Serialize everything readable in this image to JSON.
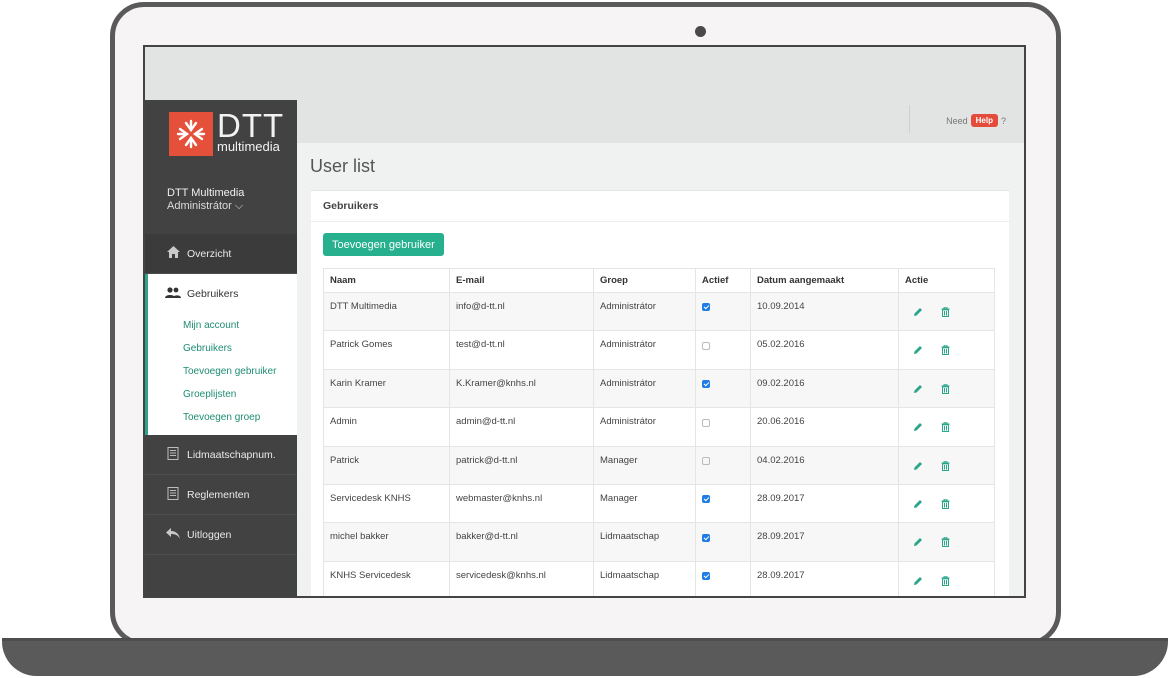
{
  "brand": {
    "logo_text": "DTT",
    "logo_sub": "multimedia",
    "accent": "#27b08e",
    "logo_color": "#e4503a"
  },
  "user": {
    "name": "DTT Multimedia",
    "role": "Administrátor ⌵"
  },
  "nav": {
    "overview": "Overzicht",
    "users": "Gebruikers",
    "sub": [
      "Mijn account",
      "Gebruikers",
      "Toevoegen gebruiker",
      "Groeplijsten",
      "Toevoegen groep"
    ],
    "membership": "Lidmaatschapnum.",
    "rules": "Reglementen",
    "logout": "Uitloggen"
  },
  "topbar": {
    "need": "Need",
    "help": "Help",
    "question": "?"
  },
  "page": {
    "title": "User list",
    "panel_title": "Gebruikers",
    "add_button": "Toevoegen gebruiker"
  },
  "table": {
    "headers": [
      "Naam",
      "E-mail",
      "Groep",
      "Actief",
      "Datum aangemaakt",
      "Actie"
    ],
    "rows": [
      {
        "name": "DTT Multimedia",
        "email": "info@d-tt.nl",
        "group": "Administrátor",
        "active": true,
        "date": "10.09.2014"
      },
      {
        "name": "Patrick Gomes",
        "email": "test@d-tt.nl",
        "group": "Administrátor",
        "active": false,
        "date": "05.02.2016"
      },
      {
        "name": "Karin Kramer",
        "email": "K.Kramer@knhs.nl",
        "group": "Administrátor",
        "active": true,
        "date": "09.02.2016"
      },
      {
        "name": "Admin",
        "email": "admin@d-tt.nl",
        "group": "Administrátor",
        "active": false,
        "date": "20.06.2016"
      },
      {
        "name": "Patrick",
        "email": "patrick@d-tt.nl",
        "group": "Manager",
        "active": false,
        "date": "04.02.2016"
      },
      {
        "name": "Servicedesk KNHS",
        "email": "webmaster@knhs.nl",
        "group": "Manager",
        "active": true,
        "date": "28.09.2017"
      },
      {
        "name": "michel bakker",
        "email": "bakker@d-tt.nl",
        "group": "Lidmaatschap",
        "active": true,
        "date": "28.09.2017"
      },
      {
        "name": "KNHS Servicedesk",
        "email": "servicedesk@knhs.nl",
        "group": "Lidmaatschap",
        "active": true,
        "date": "28.09.2017"
      }
    ]
  }
}
